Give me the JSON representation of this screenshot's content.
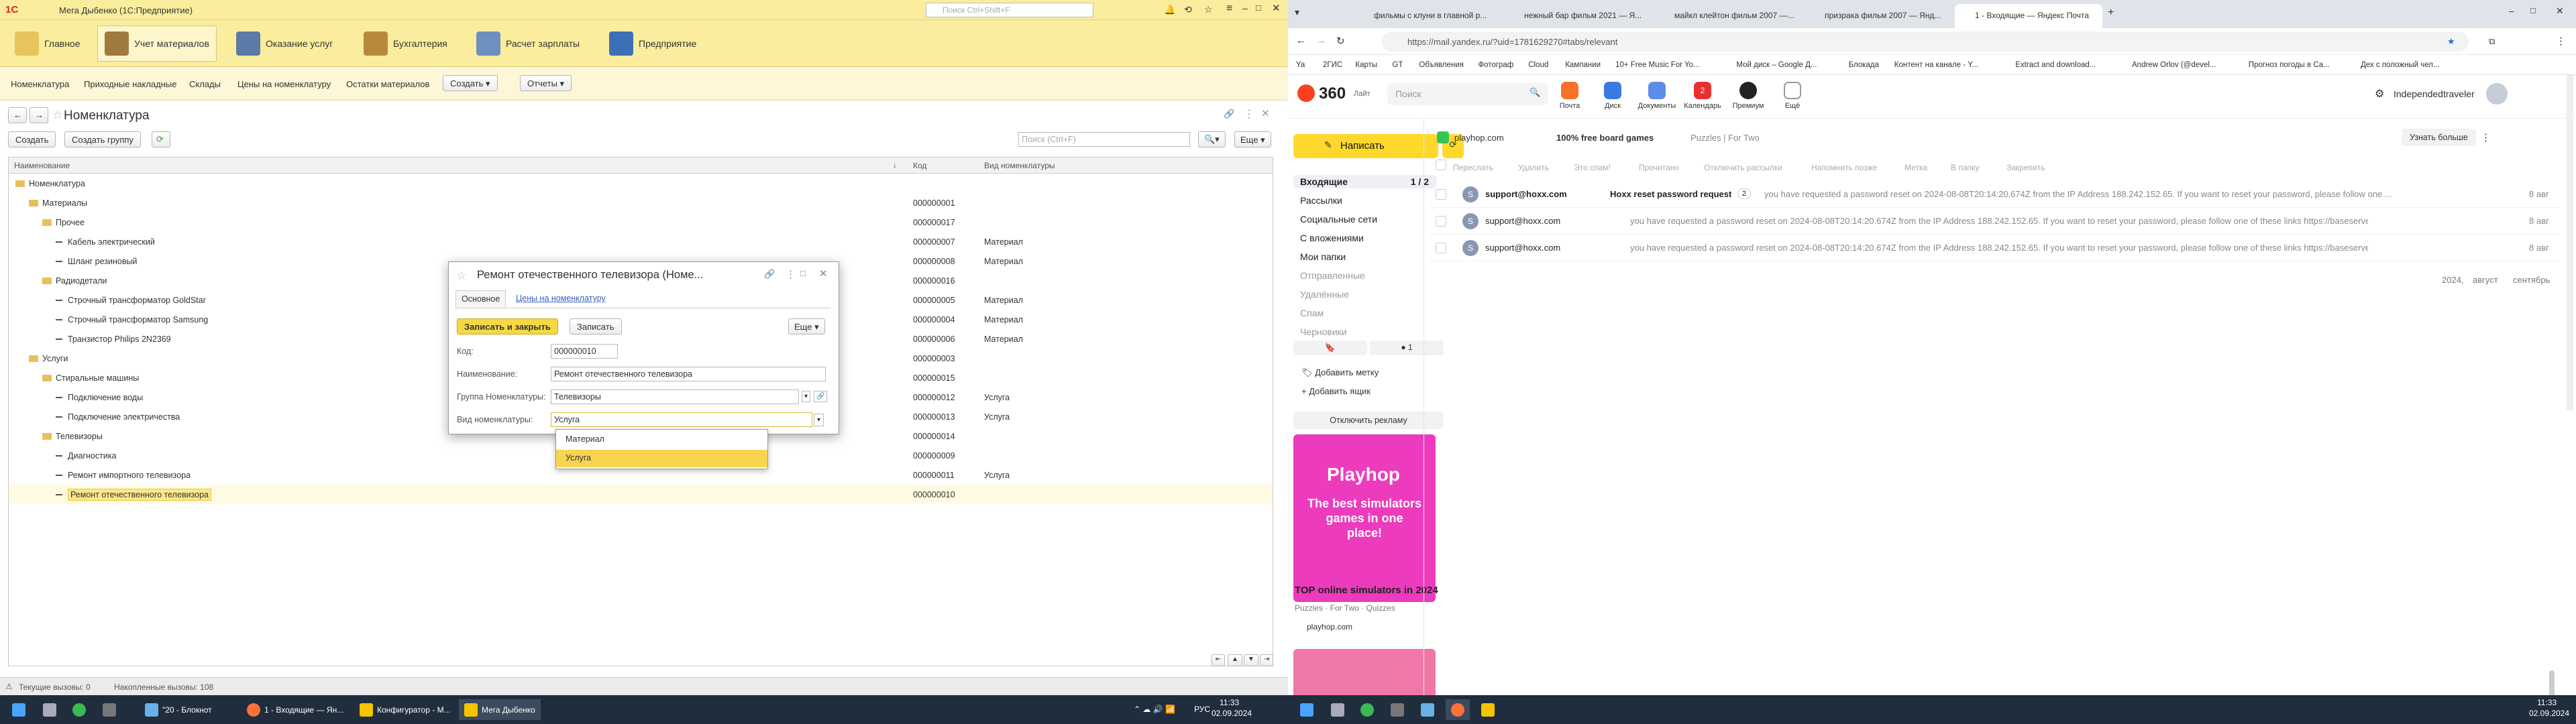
{
  "onec": {
    "title": "Мега Дыбенко (1С:Предприятие)",
    "search_placeholder": "Поиск Ctrl+Shift+F",
    "sections": [
      "Главное",
      "Учет материалов",
      "Оказание услуг",
      "Бухгалтерия",
      "Расчет зарплаты",
      "Предприятие"
    ],
    "nav": [
      "Номенклатура",
      "Приходные накладные",
      "Склады",
      "Цены на номенклатуру",
      "Остатки материалов"
    ],
    "nav_create": "Создать",
    "nav_reports": "Отчеты",
    "form_title": "Номенклатура",
    "btn_create": "Создать",
    "btn_create_group": "Создать группу",
    "grid_search_placeholder": "Поиск (Ctrl+F)",
    "btn_more": "Еще",
    "columns": [
      "Наименование",
      "Код",
      "Вид номенклатуры"
    ],
    "rows": [
      {
        "name": "Номенклатура",
        "code": "",
        "kind": "",
        "level": 0,
        "type": "folder"
      },
      {
        "name": "Материалы",
        "code": "000000001",
        "kind": "",
        "level": 1,
        "type": "folder"
      },
      {
        "name": "Прочее",
        "code": "000000017",
        "kind": "",
        "level": 2,
        "type": "folder"
      },
      {
        "name": "Кабель электрический",
        "code": "000000007",
        "kind": "Материал",
        "level": 3,
        "type": "item"
      },
      {
        "name": "Шланг резиновый",
        "code": "000000008",
        "kind": "Материал",
        "level": 3,
        "type": "item"
      },
      {
        "name": "Радиодетали",
        "code": "000000016",
        "kind": "",
        "level": 2,
        "type": "folder"
      },
      {
        "name": "Строчный трансформатор GoldStar",
        "code": "000000005",
        "kind": "Материал",
        "level": 3,
        "type": "item"
      },
      {
        "name": "Строчный трансформатор Samsung",
        "code": "000000004",
        "kind": "Материал",
        "level": 3,
        "type": "item"
      },
      {
        "name": "Транзистор Philips 2N2369",
        "code": "000000006",
        "kind": "Материал",
        "level": 3,
        "type": "item"
      },
      {
        "name": "Услуги",
        "code": "000000003",
        "kind": "",
        "level": 1,
        "type": "folder"
      },
      {
        "name": "Стиральные машины",
        "code": "000000015",
        "kind": "",
        "level": 2,
        "type": "folder"
      },
      {
        "name": "Подключение воды",
        "code": "000000012",
        "kind": "Услуга",
        "level": 3,
        "type": "item"
      },
      {
        "name": "Подключение электричества",
        "code": "000000013",
        "kind": "Услуга",
        "level": 3,
        "type": "item"
      },
      {
        "name": "Телевизоры",
        "code": "000000014",
        "kind": "",
        "level": 2,
        "type": "folder"
      },
      {
        "name": "Диагностика",
        "code": "000000009",
        "kind": "",
        "level": 3,
        "type": "item"
      },
      {
        "name": "Ремонт импортного телевизора",
        "code": "000000011",
        "kind": "Услуга",
        "level": 3,
        "type": "item"
      },
      {
        "name": "Ремонт отечественного телевизора",
        "code": "000000010",
        "kind": "",
        "level": 3,
        "type": "item",
        "selected": true
      }
    ],
    "modal": {
      "title": "Ремонт отечественного телевизора (Номе...",
      "tab_main": "Основное",
      "tab_prices": "Цены на номенклатуру",
      "btn_save_close": "Записать и закрыть",
      "btn_save": "Записать",
      "btn_more": "Еще",
      "lbl_code": "Код:",
      "code": "000000010",
      "lbl_name": "Наименование:",
      "name": "Ремонт отечественного телевизора",
      "lbl_group": "Группа Номенклатуры:",
      "group": "Телевизоры",
      "lbl_kind": "Вид номенклатуры:",
      "kind": "Услуга",
      "options": [
        "Материал",
        "Услуга"
      ]
    },
    "status_calls": "Текущие вызовы: 0",
    "status_total": "Накопленные вызовы: 108",
    "taskbar": [
      "\"20 - Блокнот",
      "1 - Входящие — Ян...",
      "Конфигуратор - М...",
      "Мега Дыбенко"
    ],
    "tray_lang": "РУС",
    "time": "11:33",
    "date": "02.09.2024"
  },
  "browser": {
    "tabs": [
      "фильмы с клуни в главной р...",
      "нежный бар фильм 2021 — Я...",
      "майкл клейтон фильм 2007 —...",
      "призрака фильм 2007 — Янд...",
      "1 - Входящие — Яндекс Почта"
    ],
    "url": "https://mail.yandex.ru/?uid=1781629270#tabs/relevant",
    "bookmarks": [
      "Ya",
      "2ГИС",
      "Карты",
      "GT",
      "Объявления",
      "Фотограф",
      "Cloud",
      "Кампании",
      "10+ Free Music For Yo...",
      "Мой диск – Google Д...",
      "Блокада",
      "Контент на канале - Y...",
      "Extract and download...",
      "Andrew Orlov (@devel...",
      "Прогноз погоды в Са...",
      "Дех с положный чел..."
    ],
    "brand": "360",
    "brand_sub": "Лайт",
    "search_placeholder": "Поиск",
    "services": [
      "Почта",
      "Диск",
      "Документы",
      "Календарь",
      "Премиум",
      "Ещё"
    ],
    "calendar_badge": "2",
    "username": "Independedtraveler",
    "compose": "Написать",
    "folders": [
      {
        "name": "Входящие",
        "count": "1 / 2",
        "active": true
      },
      {
        "name": "Рассылки"
      },
      {
        "name": "Социальные сети"
      },
      {
        "name": "С вложениями"
      },
      {
        "name": "Мои папки"
      },
      {
        "name": "Отправленные",
        "dim": true
      },
      {
        "name": "Удалённые",
        "dim": true
      },
      {
        "name": "Спам",
        "dim": true
      },
      {
        "name": "Черновики",
        "dim": true
      }
    ],
    "labels_count": "1",
    "add_label": "Добавить метку",
    "add_box": "Добавить ящик",
    "disable_ads": "Отключить рекламу",
    "ad": {
      "brand": "Playhop",
      "text": "The best simulators games in one place!",
      "title": "TOP online simulators in 2024",
      "tags": "Puzzles · For Two · Quizzes",
      "site": "playhop.com"
    },
    "promo": {
      "site": "playhop.com",
      "text": "100% free board games",
      "sub": "Puzzles | For Two",
      "more": "Узнать больше"
    },
    "toolbar": [
      "Переслать",
      "Удалить",
      "Это спам!",
      "Прочитано",
      "Отключить рассылки",
      "Напомнить позже",
      "Метка",
      "В папку",
      "Закрепить"
    ],
    "messages": [
      {
        "from": "support@hoxx.com",
        "subject": "Hoxx reset password request",
        "count": "2",
        "snippet": "you have requested a password reset on 2024-08-08T20:14:20.674Z from the IP Address 188.242.152.65. If you want to reset your password, please follow one ...",
        "date": "8 авг",
        "bold": true
      },
      {
        "from": "support@hoxx.com",
        "subject": "",
        "snippet": "you have requested a password reset on 2024-08-08T20:14:20.674Z from the IP Address 188.242.152.65. If you want to reset your password, please follow one of these links https://baseserver.org/a...",
        "date": "8 авг"
      },
      {
        "from": "support@hoxx.com",
        "subject": "",
        "snippet": "you have requested a password reset on 2024-08-08T20:14:20.674Z from the IP Address 188.242.152.65. If you want to reset your password, please follow one of these links https://baseserver.org/a...",
        "date": "8 авг"
      }
    ],
    "timeline": [
      "2024,",
      "август",
      "сентябрь"
    ],
    "time": "11:33",
    "date": "02.09.2024"
  },
  "colors": {
    "onec_yellow": "#fbed9e",
    "yandex_yellow": "#ffd82b",
    "taskbar": "#1f2d3d"
  }
}
